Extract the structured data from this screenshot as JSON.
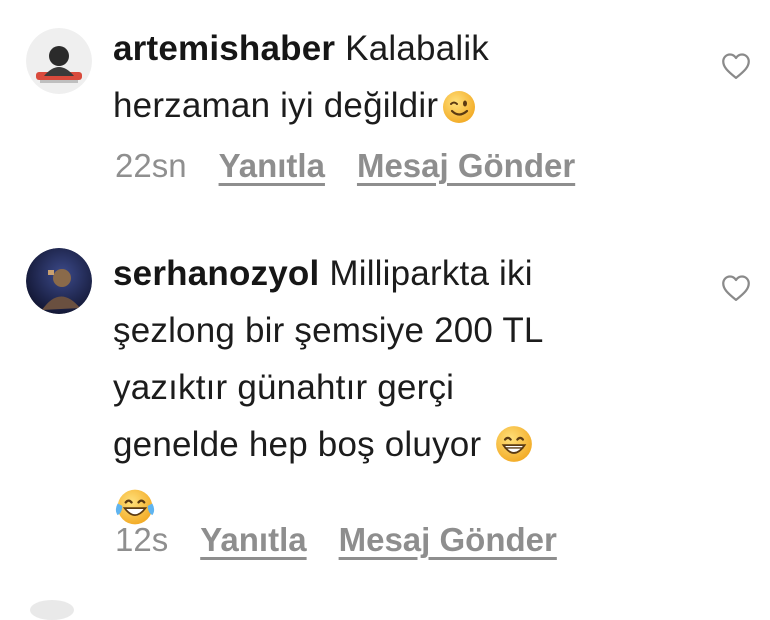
{
  "comments": [
    {
      "username": "artemishaber",
      "text_lines": [
        "Kalabalik",
        "herzaman iyi değildir"
      ],
      "emojis": [
        "wink-face"
      ],
      "time": "22sn",
      "reply_label": "Yanıtla",
      "message_label": "Mesaj Gönder",
      "like_icon": "heart-outline"
    },
    {
      "username": "serhanozyol",
      "text_lines": [
        "Milliparkta iki",
        "şezlong bir şemsiye 200 TL",
        "yazıktır günahtır gerçi",
        "genelde hep boş oluyor"
      ],
      "emojis": [
        "grinning-face",
        "tears-of-joy-face"
      ],
      "time": "12s",
      "reply_label": "Yanıtla",
      "message_label": "Mesaj Gönder",
      "like_icon": "heart-outline"
    }
  ],
  "colors": {
    "text": "#1b1b1b",
    "meta_gray": "#8e8e8e",
    "emoji_yellow": "#f7c33c"
  }
}
